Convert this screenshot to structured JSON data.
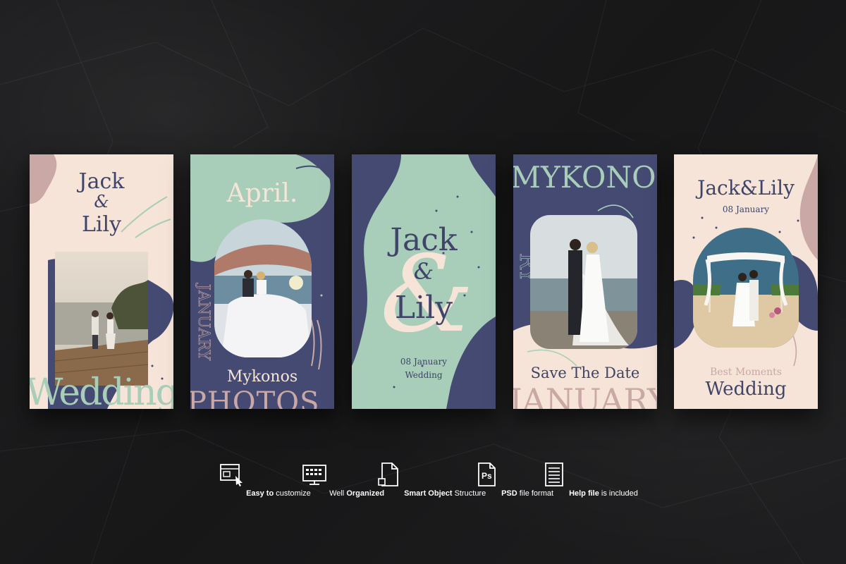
{
  "cards": [
    {
      "id": "card1",
      "title_line1": "Jack",
      "title_amp": "&",
      "title_line2": "Lily",
      "bottom_word": "Wedding"
    },
    {
      "id": "card2",
      "top_word": "April.",
      "place": "Mykonos",
      "bottom_word": "PHOTOS"
    },
    {
      "id": "card3",
      "title_line1": "Jack",
      "title_amp": "&",
      "title_line2": "Lily",
      "date": "08 January",
      "subtitle": "Wedding"
    },
    {
      "id": "card4",
      "top_word": "MYKONOS",
      "caption": "Save The Date",
      "bottom_word": "JANUARY"
    },
    {
      "id": "card5",
      "title": "Jack&Lily",
      "date": "08 January",
      "caption_small": "Best Moments",
      "caption_big": "Wedding"
    }
  ],
  "features": [
    {
      "icon": "customize-icon",
      "bold": "Easy to",
      "rest": " customize"
    },
    {
      "icon": "keyboard-monitor-icon",
      "pre": "Well ",
      "bold": "Organized"
    },
    {
      "icon": "file-icon",
      "bold": "Smart Object",
      "rest": " Structure"
    },
    {
      "icon": "photoshop-file-icon",
      "bold": "PSD",
      "rest": " file format",
      "ps": "Ps"
    },
    {
      "icon": "document-lines-icon",
      "bold": "Help file",
      "rest": " is included"
    }
  ],
  "colors": {
    "navy": "#454a73",
    "mint": "#a8cdb8",
    "cream": "#f5e4d7",
    "rose": "#c9a8a6"
  }
}
